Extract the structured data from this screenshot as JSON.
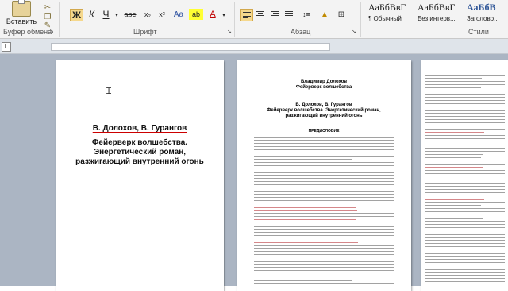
{
  "ribbon": {
    "paste_label": "Вставить",
    "groups": {
      "clipboard": "Буфер обмена",
      "font": "Шрифт",
      "paragraph": "Абзац",
      "styles": "Стили"
    },
    "format_buttons": [
      "Ж",
      "К",
      "Ч",
      "abe",
      "x₂",
      "x²",
      "Aa",
      "ab",
      "A"
    ],
    "styles": [
      {
        "sample": "АаБбВвГ",
        "name": "¶ Обычный"
      },
      {
        "sample": "АаБбВвГ",
        "name": "Без интерв..."
      },
      {
        "sample": "АаБбВ",
        "name": "Заголово..."
      }
    ]
  },
  "ruler": {
    "tab_symbol": "L"
  },
  "pages": {
    "page1": {
      "author": "В. Долохов, В. Гурангов",
      "title_lines": [
        "Фейерверк волшебства.",
        "Энергетический роман,",
        "разжигающий внутренний огонь"
      ]
    },
    "page2": {
      "header_lines": [
        "Владимир Долохов",
        "Фейерверк волшебства"
      ],
      "author": "В. Долохов, В. Гурангов",
      "title_lines": [
        "Фейерверк волшебства. Энергетический роман,",
        "разжигающий внутренний огонь"
      ],
      "section": "ПРЕДИСЛОВИЕ"
    }
  }
}
